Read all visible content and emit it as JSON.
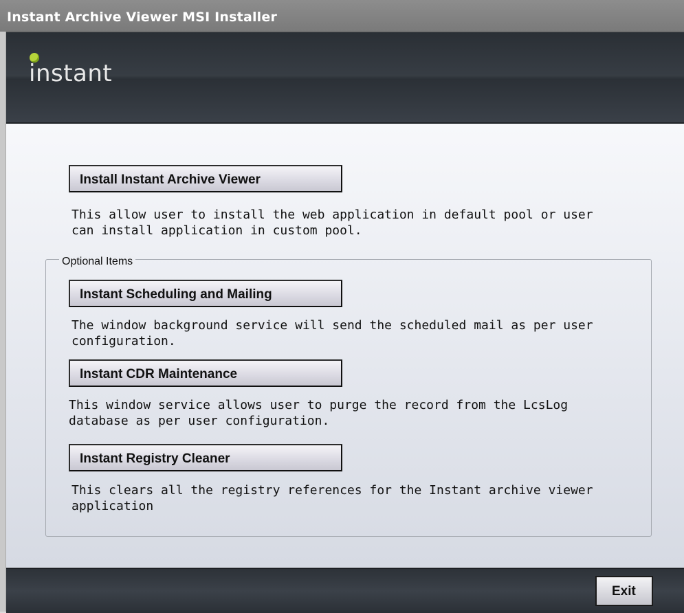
{
  "window": {
    "title": "Instant Archive Viewer MSI Installer"
  },
  "header": {
    "logo_text": "instant"
  },
  "main": {
    "install_button": "Install Instant Archive Viewer",
    "install_desc": "This allow user to install the web application in default pool or user can install application in custom pool.",
    "optional_group_label": "Optional Items",
    "optional_items": [
      {
        "button": "Instant Scheduling and Mailing",
        "desc": "The window background service will send the scheduled mail as per user configuration."
      },
      {
        "button": "Instant CDR Maintenance",
        "desc": "This window service allows user to purge the record from the LcsLog database as per user configuration."
      },
      {
        "button": "Instant Registry Cleaner",
        "desc": "This clears all the registry references for the Instant archive viewer application"
      }
    ]
  },
  "footer": {
    "exit_button": "Exit"
  }
}
